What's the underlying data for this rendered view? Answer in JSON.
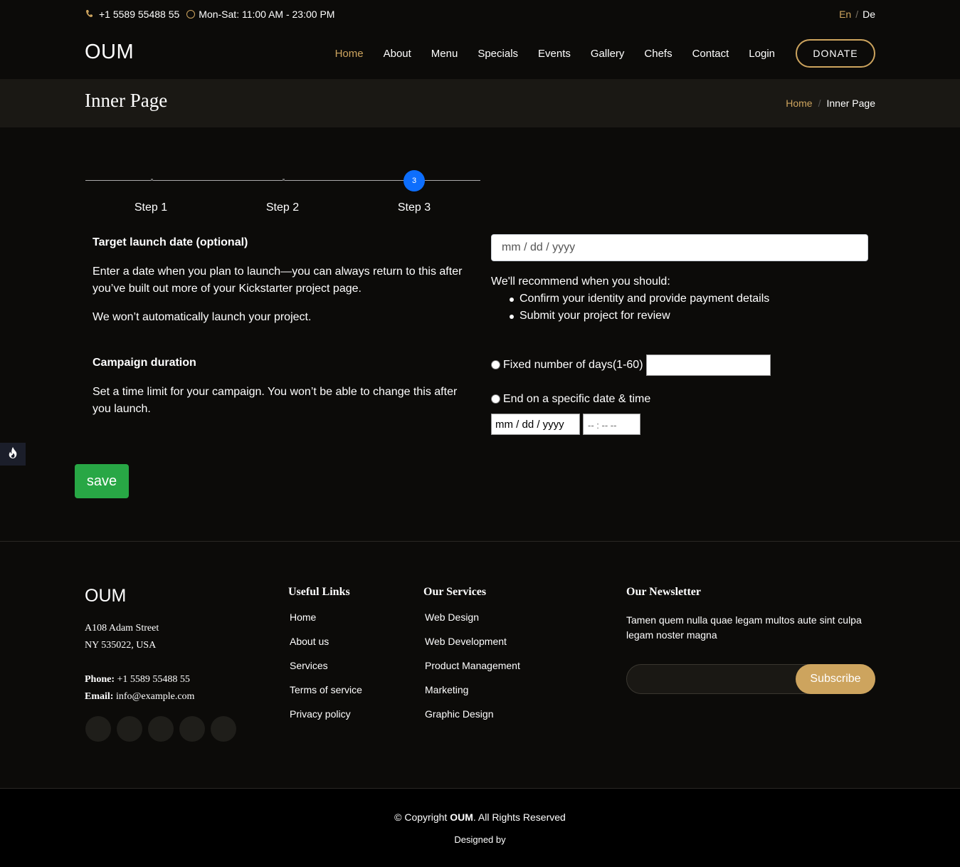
{
  "topbar": {
    "phone": "+1 5589 55488 55",
    "hours": "Mon-Sat: 11:00 AM - 23:00 PM",
    "lang_en": "En",
    "lang_sep": "/",
    "lang_de": "De"
  },
  "header": {
    "logo": "OUM",
    "nav": [
      "Home",
      "About",
      "Menu",
      "Specials",
      "Events",
      "Gallery",
      "Chefs",
      "Contact",
      "Login"
    ],
    "active_nav": "Home",
    "donate": "DONATE"
  },
  "breadcrumbs": {
    "title": "Inner Page",
    "home": "Home",
    "sep": "/",
    "current": "Inner Page"
  },
  "stepper": {
    "current_number": "3",
    "steps": [
      "Step 1",
      "Step 2",
      "Step 3"
    ]
  },
  "launch": {
    "title": "Target launch date (optional)",
    "text1": "Enter a date when you plan to launch—you can always return to this after you’ve built out more of your Kickstarter project page.",
    "text2": "We won’t automatically launch your project.",
    "date_placeholder": "mm / dd / yyyy",
    "recommend_title": "We'll recommend when you should:",
    "recommend_items": [
      "Confirm your identity and provide payment details",
      "Submit your project for review"
    ]
  },
  "duration": {
    "title": "Campaign duration",
    "text": "Set a time limit for your campaign. You won’t be able to change this after you launch.",
    "option_fixed": "Fixed number of days(1-60)",
    "option_end": "End on a specific date & time",
    "date_placeholder": "mm / dd / yyyy",
    "time_placeholder": "-- : --   --"
  },
  "save_label": "save",
  "footer": {
    "logo": "OUM",
    "address_line1": "A108 Adam Street",
    "address_line2": "NY 535022, USA",
    "phone_label": "Phone:",
    "phone": " +1 5589 55488 55",
    "email_label": "Email:",
    "email": " info@example.com",
    "useful_links_title": "Useful Links",
    "useful_links": [
      "Home",
      "About us",
      "Services",
      "Terms of service",
      "Privacy policy"
    ],
    "services_title": "Our Services",
    "services": [
      "Web Design",
      "Web Development",
      "Product Management",
      "Marketing",
      "Graphic Design"
    ],
    "newsletter_title": "Our Newsletter",
    "newsletter_text": "Tamen quem nulla quae legam multos aute sint culpa legam noster magna",
    "subscribe": "Subscribe"
  },
  "copyright": {
    "prefix": "© Copyright ",
    "brand": "OUM",
    "suffix": ". All Rights Reserved",
    "designed_by": "Designed by"
  },
  "colors": {
    "accent": "#cda45e",
    "background": "#0c0b09",
    "save": "#28a745",
    "step_active": "#0d6efd"
  }
}
